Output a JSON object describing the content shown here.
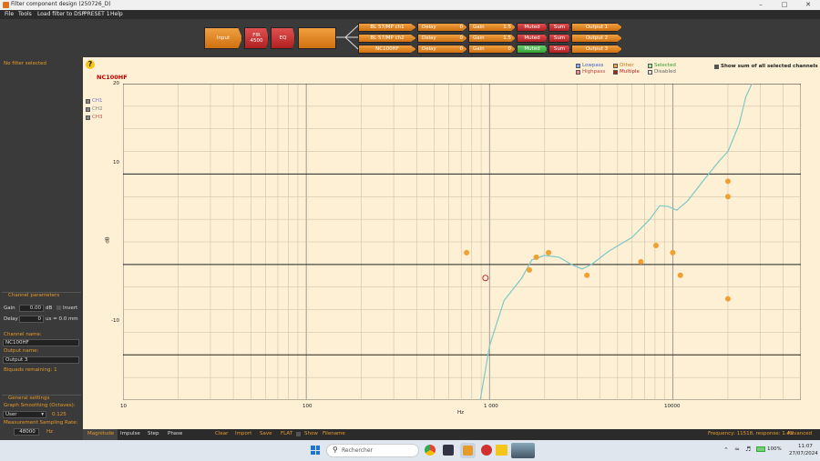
{
  "window": {
    "title": "Filter component design (250726_D)"
  },
  "menu": [
    "File",
    "Tools",
    "Load filter to DSP",
    "PRESET 1",
    "Help"
  ],
  "pipeline": {
    "input": "Input",
    "fir": {
      "label": "FIR",
      "value": "4500"
    },
    "eq": "EQ",
    "channels": [
      {
        "name": "BL 57/MP ch1",
        "delay_label": "Delay",
        "delay_value": "0",
        "delay_unit": "us",
        "gain_label": "Gain",
        "gain_value": "1.5",
        "gain_unit": "dB",
        "muted": "Muted",
        "state": "Sum",
        "output": "Output 1"
      },
      {
        "name": "BL 57/MP ch2",
        "delay_label": "Delay",
        "delay_value": "0",
        "delay_unit": "us",
        "gain_label": "Gain",
        "gain_value": "1.5",
        "gain_unit": "dB",
        "muted": "Muted",
        "state": "Sum",
        "output": "Output 2"
      },
      {
        "name": "NC100HF",
        "delay_label": "Delay",
        "delay_value": "0",
        "delay_unit": "us",
        "gain_label": "Gain",
        "gain_value": "0",
        "gain_unit": "dB",
        "muted": "Muted",
        "state": "Sum",
        "output": "Output 3"
      }
    ]
  },
  "left_panel": {
    "no_filter": "No filter selected",
    "channel_params_title": "Channel parameters",
    "gain_label": "Gain",
    "gain_value": "0.00",
    "gain_unit": "dB",
    "invert_label": "Invert",
    "delay_label": "Delay",
    "delay_value": "0",
    "delay_unit": "us = 0.0 mm",
    "channel_name_label": "Channel name:",
    "channel_name": "NC100HF",
    "output_name_label": "Output name:",
    "output_name": "Output 3",
    "biquads": "Biquads remaining: 1",
    "general_title": "General settings",
    "smoothing_label": "Graph Smoothing (Octaves):",
    "smoothing_mode": "User",
    "smoothing_value": "0.125",
    "sampling_label": "Measurement Sampling Rate:",
    "sampling_value": "48000",
    "sampling_unit": "Hz"
  },
  "graph": {
    "help_icon": "?",
    "channel_title": "NC100HF",
    "channels": [
      "CH1",
      "CH2",
      "CH3"
    ],
    "legend": {
      "lowpass": "Lowpass",
      "highpass": "Highpass",
      "other": "Other",
      "multiple": "Multiple",
      "selected": "Selected",
      "disabled": "Disabled"
    },
    "show_sum": "Show sum of all selected channels",
    "y_ticks": [
      "20",
      "10",
      "-10"
    ],
    "y_unit": "dB",
    "x_ticks": [
      "10",
      "100",
      "1 000",
      "10000"
    ],
    "x_unit": "Hz"
  },
  "chart_data": {
    "type": "line",
    "x_scale": "log",
    "xlim": [
      10,
      50000
    ],
    "ylim": [
      -15,
      20
    ],
    "grid": true,
    "curve": [
      [
        890,
        -15
      ],
      [
        1000,
        -9
      ],
      [
        1200,
        -4
      ],
      [
        1500,
        -1.5
      ],
      [
        1700,
        0.5
      ],
      [
        2000,
        1
      ],
      [
        2400,
        0.8
      ],
      [
        2800,
        0
      ],
      [
        3200,
        -0.5
      ],
      [
        3600,
        0
      ],
      [
        4500,
        1.5
      ],
      [
        6000,
        3
      ],
      [
        7500,
        5
      ],
      [
        8500,
        6.5
      ],
      [
        9500,
        6.4
      ],
      [
        10500,
        6
      ],
      [
        12000,
        7
      ],
      [
        15000,
        9.5
      ],
      [
        18000,
        11.5
      ],
      [
        20000,
        12.5
      ],
      [
        23000,
        15.5
      ],
      [
        25000,
        18.5
      ],
      [
        27000,
        20
      ]
    ],
    "points_orange": [
      [
        750,
        1.3
      ],
      [
        1650,
        -0.6
      ],
      [
        1800,
        0.8
      ],
      [
        2100,
        1.3
      ],
      [
        3400,
        -1.2
      ],
      [
        6700,
        0.3
      ],
      [
        8100,
        2.1
      ],
      [
        10000,
        1.3
      ],
      [
        11000,
        -1.2
      ],
      [
        20000,
        9.2
      ],
      [
        20000,
        7.5
      ],
      [
        20000,
        -3.8
      ]
    ],
    "points_red": [
      [
        950,
        -1.5
      ]
    ]
  },
  "bottom": {
    "tabs": [
      "Magnitude",
      "Impulse",
      "Step",
      "Phase"
    ],
    "actions": [
      "Clear",
      "Import",
      "Save",
      "FLAT",
      "Show",
      "Filename"
    ],
    "status": "Frequency: 11518, response: 1.45",
    "advanced": "Advanced"
  },
  "taskbar": {
    "search_placeholder": "Rechercher",
    "battery": "100%",
    "time": "11:07",
    "date": "27/07/2024"
  }
}
